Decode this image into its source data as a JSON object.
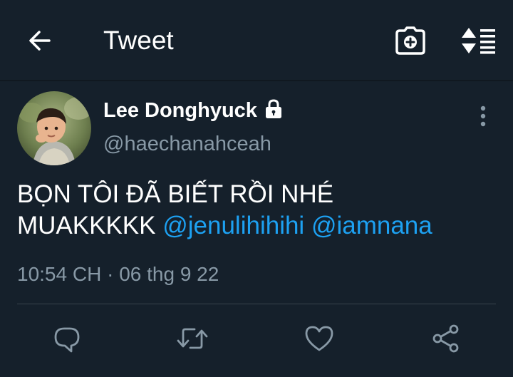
{
  "header": {
    "title": "Tweet",
    "back_icon": "arrow-left-icon",
    "camera_icon": "camera-plus-icon",
    "sort_icon": "sort-list-icon"
  },
  "tweet": {
    "author": {
      "display_name": "Lee Donghyuck",
      "handle": "@haechanahceah",
      "protected_icon": "lock-icon"
    },
    "text_line1": "BỌN TÔI ĐÃ BIẾT RỒI NHÉ",
    "text_line2_prefix": "MUAKKKKK ",
    "mentions": [
      "@jenulihihihi",
      "@iamnana"
    ],
    "timestamp_time": "10:54 CH",
    "timestamp_sep": "·",
    "timestamp_date": "06 thg 9 22"
  },
  "actions": [
    {
      "name": "reply",
      "icon": "reply-icon"
    },
    {
      "name": "retweet",
      "icon": "retweet-icon"
    },
    {
      "name": "like",
      "icon": "heart-icon"
    },
    {
      "name": "share",
      "icon": "share-icon"
    }
  ],
  "colors": {
    "background": "#15202b",
    "text_primary": "#ffffff",
    "text_secondary": "#8899a6",
    "accent": "#1da1f2",
    "divider": "#38444d"
  }
}
